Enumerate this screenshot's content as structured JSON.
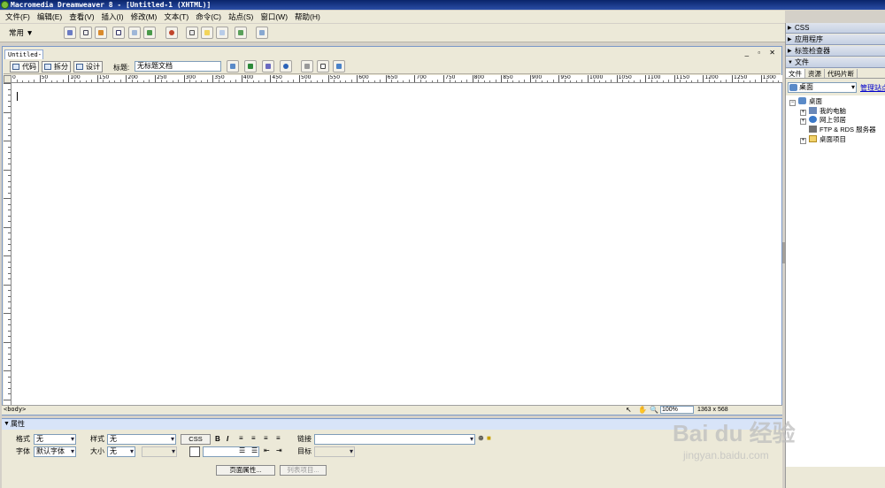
{
  "window": {
    "title": "Macromedia Dreamweaver 8 - [Untitled-1 (XHTML)]"
  },
  "menu": [
    "文件(F)",
    "编辑(E)",
    "查看(V)",
    "插入(I)",
    "修改(M)",
    "文本(T)",
    "命令(C)",
    "站点(S)",
    "窗口(W)",
    "帮助(H)"
  ],
  "insert_bar": {
    "category": "常用"
  },
  "document": {
    "tab": "Untitled-1",
    "view_buttons": {
      "code": "代码",
      "split": "拆分",
      "design": "设计"
    },
    "title_label": "标题:",
    "title_value": "无标题文档",
    "ruler_ticks": [
      "0",
      "50",
      "100",
      "150",
      "200",
      "250",
      "300",
      "350",
      "400",
      "450",
      "500",
      "550",
      "600",
      "650",
      "700",
      "750",
      "800",
      "850",
      "900",
      "950",
      "1000",
      "1050",
      "1100",
      "1150",
      "1200",
      "1250",
      "1300"
    ],
    "tag_selector": "<body>",
    "zoom": "100%",
    "window_size": "1363 x 568"
  },
  "properties": {
    "header": "属性",
    "format_label": "格式",
    "format_value": "无",
    "style_label": "样式",
    "style_value": "无",
    "css_button": "CSS",
    "bold": "B",
    "italic": "I",
    "link_label": "链接",
    "font_label": "字体",
    "font_value": "默认字体",
    "size_label": "大小",
    "size_value": "无",
    "target_label": "目标",
    "page_props_button": "页面属性...",
    "list_item_button": "列表项目..."
  },
  "panels": {
    "groups": [
      "CSS",
      "应用程序",
      "标签检查器",
      "文件"
    ],
    "file_tabs": [
      "文件",
      "资源",
      "代码片断"
    ],
    "site_select": "桌面",
    "manage_sites": "管理站点",
    "tree": [
      {
        "label": "桌面",
        "expander": "−",
        "icon": "desktop-icon",
        "depth": 0
      },
      {
        "label": "我的电脑",
        "expander": "+",
        "icon": "computer-icon",
        "depth": 1
      },
      {
        "label": "网上邻居",
        "expander": "+",
        "icon": "network-icon",
        "depth": 1
      },
      {
        "label": "FTP & RDS 服务器",
        "expander": "",
        "icon": "server-icon",
        "depth": 1
      },
      {
        "label": "桌面项目",
        "expander": "+",
        "icon": "folder-icon",
        "depth": 1
      }
    ]
  },
  "watermark": {
    "brand": "Bai du 经验",
    "url": "jingyan.baidu.com"
  }
}
